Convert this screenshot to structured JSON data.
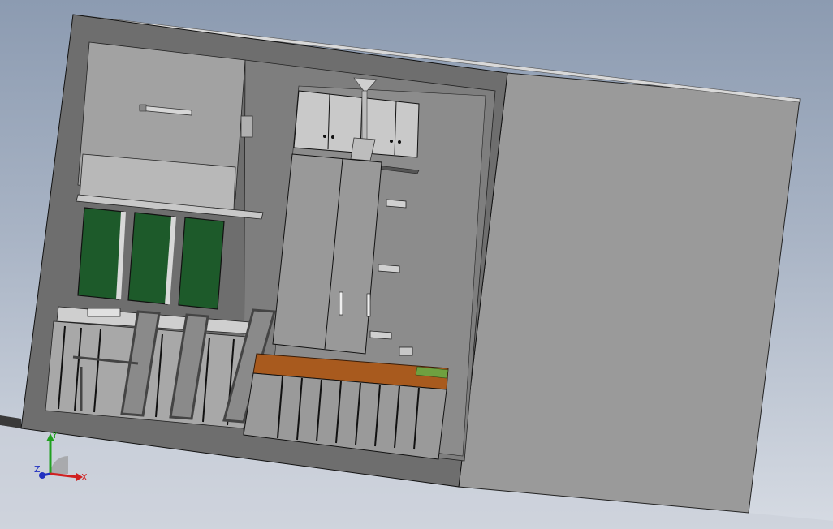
{
  "scene": {
    "colors": {
      "background_top": "#8c9bb1",
      "background_bottom": "#d6dbe3",
      "outer_wall": "#6e6e6e",
      "side_wall": "#9a9a9a",
      "inner_wall": "#7e7e7e",
      "back_wall": "#a2a2a2",
      "window_glass": "#1d5a2a",
      "bench_wood": "#a85a1e",
      "accent_green": "#6fa040"
    },
    "icons": [
      "ceiling-fan-icon",
      "cabinet-icon",
      "door-icon",
      "bench-icon",
      "chair-icon",
      "window-icon",
      "light-fixture-icon",
      "switch-plate-icon"
    ]
  },
  "triad": {
    "x_label": "X",
    "y_label": "Y",
    "z_label": "Z",
    "x_color": "#d02020",
    "y_color": "#20a020",
    "z_color": "#2030c0"
  }
}
